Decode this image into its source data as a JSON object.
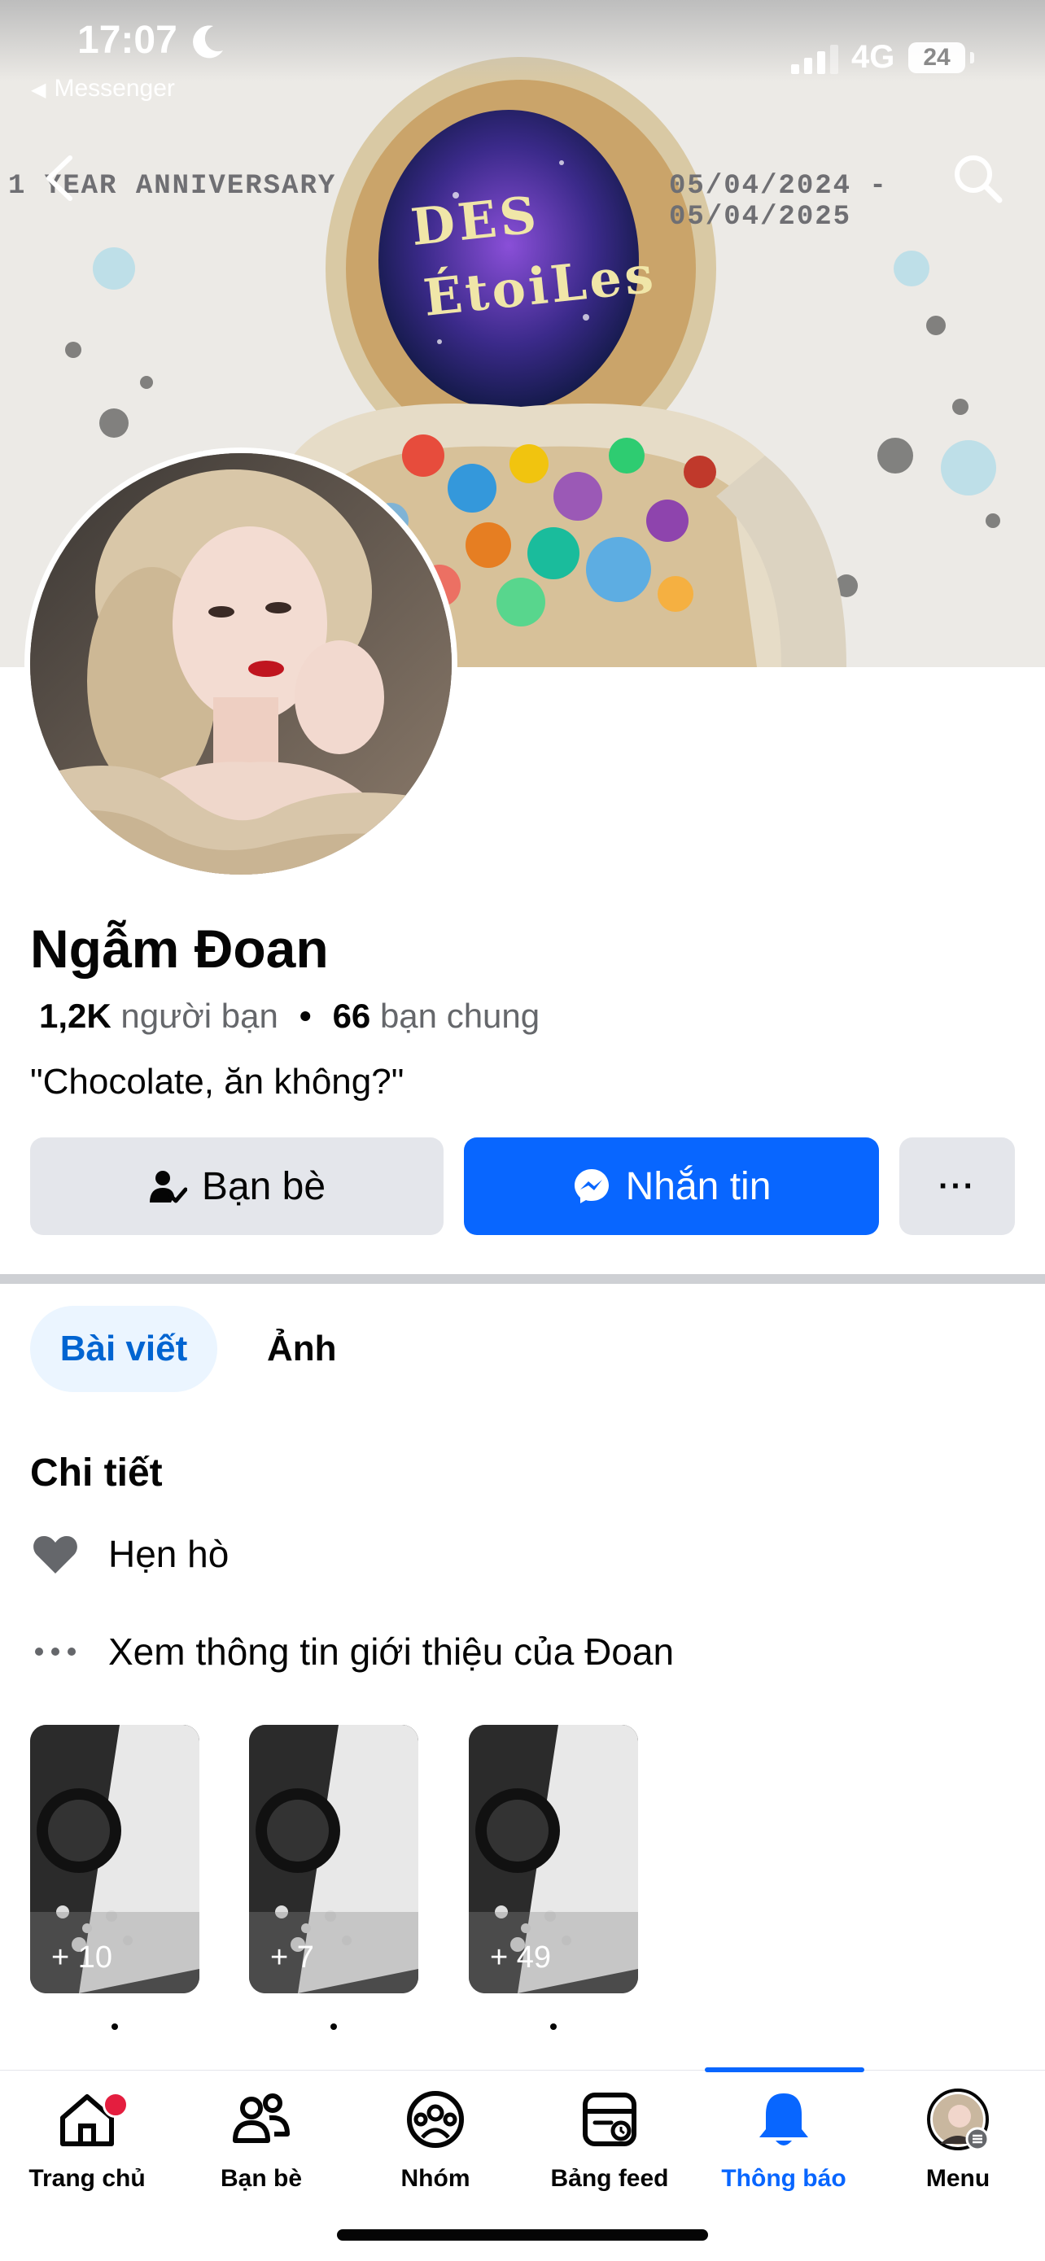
{
  "status_bar": {
    "time": "17:07",
    "network": "4G",
    "battery": "24",
    "back_app": "Messenger"
  },
  "cover": {
    "left_text": "1 YEAR ANNIVERSARY",
    "right_text": "05/04/2024 - 05/04/2025",
    "title_line1": "DES",
    "title_line2": "ÉtoiLes"
  },
  "profile": {
    "name": "Ngẫm Đoan",
    "friends_count": "1,2K",
    "friends_label": "người bạn",
    "mutual_count": "66",
    "mutual_label": "bạn chung",
    "separator": "•",
    "bio": "\"Chocolate, ăn không?\""
  },
  "actions": {
    "friends_label": "Bạn bè",
    "message_label": "Nhắn tin",
    "more_label": "···"
  },
  "tabs": [
    {
      "label": "Bài viết",
      "active": true
    },
    {
      "label": "Ảnh",
      "active": false
    }
  ],
  "details": {
    "title": "Chi tiết",
    "dating": "Hẹn hò",
    "about": "Xem thông tin giới thiệu của Đoan"
  },
  "highlights": [
    {
      "count": "+ 10"
    },
    {
      "count": "+ 7"
    },
    {
      "count": "+ 49"
    }
  ],
  "bottom_nav": [
    {
      "label": "Trang chủ",
      "icon": "home-icon",
      "badge": true
    },
    {
      "label": "Bạn bè",
      "icon": "friends-icon"
    },
    {
      "label": "Nhóm",
      "icon": "groups-icon"
    },
    {
      "label": "Bảng feed",
      "icon": "feed-icon"
    },
    {
      "label": "Thông báo",
      "icon": "bell-icon",
      "active": true
    },
    {
      "label": "Menu",
      "icon": "profile-menu-icon"
    }
  ],
  "colors": {
    "primary": "#0866ff",
    "button_gray": "#e4e6eb",
    "active_tab_bg": "#ebf5ff",
    "secondary_text": "#65676b",
    "badge": "#e41e3f"
  }
}
